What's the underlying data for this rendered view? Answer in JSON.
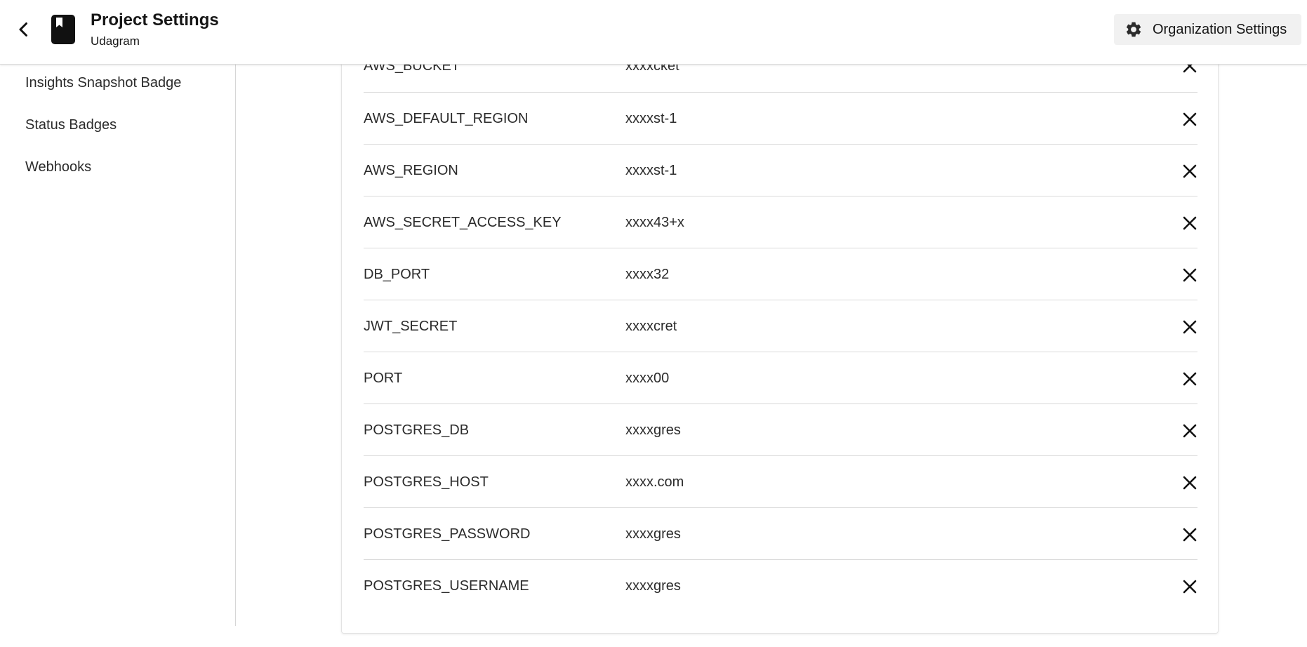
{
  "header": {
    "title": "Project Settings",
    "subtitle": "Udagram",
    "org_button_label": "Organization Settings",
    "icons": {
      "back": "chevron-left-icon",
      "project": "bookmark-book-icon",
      "org": "gear-icon"
    }
  },
  "sidebar": {
    "items": [
      {
        "label": "Insights Snapshot Badge"
      },
      {
        "label": "Status Badges"
      },
      {
        "label": "Webhooks"
      }
    ]
  },
  "env_vars": [
    {
      "name": "AWS_BUCKET",
      "value": "xxxxcket"
    },
    {
      "name": "AWS_DEFAULT_REGION",
      "value": "xxxxst-1"
    },
    {
      "name": "AWS_REGION",
      "value": "xxxxst-1"
    },
    {
      "name": "AWS_SECRET_ACCESS_KEY",
      "value": "xxxx43+x"
    },
    {
      "name": "DB_PORT",
      "value": "xxxx32"
    },
    {
      "name": "JWT_SECRET",
      "value": "xxxxcret"
    },
    {
      "name": "PORT",
      "value": "xxxx00"
    },
    {
      "name": "POSTGRES_DB",
      "value": "xxxxgres"
    },
    {
      "name": "POSTGRES_HOST",
      "value": "xxxx.com"
    },
    {
      "name": "POSTGRES_PASSWORD",
      "value": "xxxxgres"
    },
    {
      "name": "POSTGRES_USERNAME",
      "value": "xxxxgres"
    }
  ],
  "colors": {
    "header_bg": "#ffffff",
    "org_button_bg": "#f1f1f1",
    "text": "#161616",
    "divider": "#d9d9d9"
  }
}
